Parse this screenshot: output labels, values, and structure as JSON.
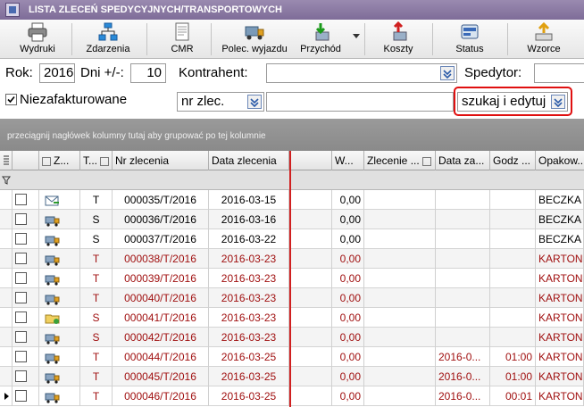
{
  "window": {
    "title": "LISTA ZLECEŃ SPEDYCYJNYCH/TRANSPORTOWYCH"
  },
  "toolbar": {
    "buttons": [
      {
        "label": "Wydruki",
        "icon": "printer-icon"
      },
      {
        "label": "Zdarzenia",
        "icon": "events-icon"
      },
      {
        "label": "CMR",
        "icon": "document-icon"
      },
      {
        "label": "Polec. wyjazdu",
        "icon": "truck-icon"
      },
      {
        "label": "Przychód",
        "icon": "income-icon"
      },
      {
        "label": "Koszty",
        "icon": "costs-icon"
      },
      {
        "label": "Status",
        "icon": "status-icon"
      },
      {
        "label": "Wzorce",
        "icon": "templates-icon"
      }
    ]
  },
  "filters": {
    "year_label": "Rok:",
    "year_value": "2016",
    "days_label": "Dni +/-:",
    "days_value": "10",
    "contractor_label": "Kontrahent:",
    "contractor_value": "",
    "forwarder_label": "Spedytor:",
    "forwarder_value": "",
    "uninvoiced_label": "Niezafakturowane",
    "uninvoiced_checked": true,
    "search_field_value": "nr zlec.",
    "search_text_value": "",
    "search_mode_value": "szukaj i edytuj"
  },
  "groupbar": {
    "hint": "przeciągnij nagłówek kolumny tutaj aby grupować po tej kolumnie"
  },
  "grid": {
    "columns": [
      "Z...",
      "T...",
      "Nr zlecenia",
      "Data zlecenia",
      "W...",
      "Zlecenie ...",
      "Data za...",
      "Godz ...",
      "Opakow..."
    ],
    "rows": [
      {
        "icon": "envelope-truck-icon",
        "typ": "T",
        "nr": "000035/T/2016",
        "data": "2016-03-15",
        "w": "0,00",
        "zlec": "",
        "dataza": "",
        "godz": "",
        "opak": "BECZKA",
        "red": false
      },
      {
        "icon": "truck-icon",
        "typ": "S",
        "nr": "000036/T/2016",
        "data": "2016-03-16",
        "w": "0,00",
        "zlec": "",
        "dataza": "",
        "godz": "",
        "opak": "BECZKA",
        "red": false
      },
      {
        "icon": "truck-icon",
        "typ": "S",
        "nr": "000037/T/2016",
        "data": "2016-03-22",
        "w": "0,00",
        "zlec": "",
        "dataza": "",
        "godz": "",
        "opak": "BECZKA",
        "red": false
      },
      {
        "icon": "truck-icon",
        "typ": "T",
        "nr": "000038/T/2016",
        "data": "2016-03-23",
        "w": "0,00",
        "zlec": "",
        "dataza": "",
        "godz": "",
        "opak": "KARTON",
        "red": true
      },
      {
        "icon": "truck-icon",
        "typ": "T",
        "nr": "000039/T/2016",
        "data": "2016-03-23",
        "w": "0,00",
        "zlec": "",
        "dataza": "",
        "godz": "",
        "opak": "KARTON",
        "red": true
      },
      {
        "icon": "truck-icon",
        "typ": "T",
        "nr": "000040/T/2016",
        "data": "2016-03-23",
        "w": "0,00",
        "zlec": "",
        "dataza": "",
        "godz": "",
        "opak": "KARTON",
        "red": true
      },
      {
        "icon": "folder-icon",
        "typ": "S",
        "nr": "000041/T/2016",
        "data": "2016-03-23",
        "w": "0,00",
        "zlec": "",
        "dataza": "",
        "godz": "",
        "opak": "KARTON",
        "red": true
      },
      {
        "icon": "truck-icon",
        "typ": "S",
        "nr": "000042/T/2016",
        "data": "2016-03-23",
        "w": "0,00",
        "zlec": "",
        "dataza": "",
        "godz": "",
        "opak": "KARTON",
        "red": true
      },
      {
        "icon": "truck-icon",
        "typ": "T",
        "nr": "000044/T/2016",
        "data": "2016-03-25",
        "w": "0,00",
        "zlec": "",
        "dataza": "2016-0...",
        "godz": "01:00",
        "opak": "KARTON",
        "red": true
      },
      {
        "icon": "truck-icon",
        "typ": "T",
        "nr": "000045/T/2016",
        "data": "2016-03-25",
        "w": "0,00",
        "zlec": "",
        "dataza": "2016-0...",
        "godz": "01:00",
        "opak": "KARTON",
        "red": true
      },
      {
        "icon": "truck-icon",
        "typ": "T",
        "nr": "000046/T/2016",
        "data": "2016-03-25",
        "w": "0,00",
        "zlec": "",
        "dataza": "2016-0...",
        "godz": "00:01",
        "opak": "KARTON",
        "red": true
      }
    ]
  },
  "colors": {
    "red_text": "#a01010",
    "highlight": "#e01010",
    "title_bar": "#8a7aa6"
  }
}
